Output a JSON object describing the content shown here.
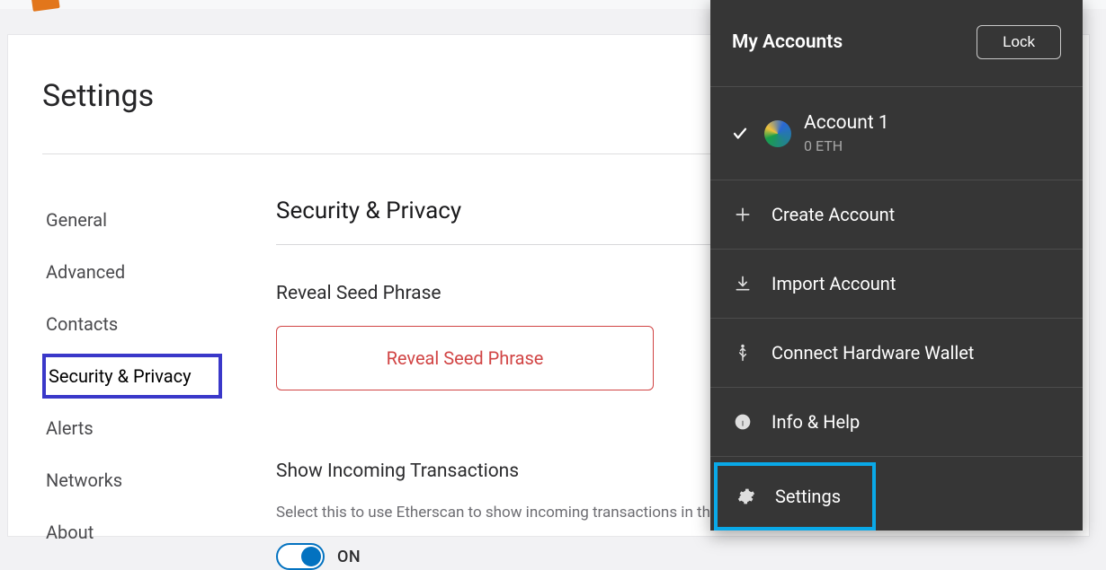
{
  "page": {
    "title": "Settings"
  },
  "sidebar": {
    "items": [
      {
        "label": "General"
      },
      {
        "label": "Advanced"
      },
      {
        "label": "Contacts"
      },
      {
        "label": "Security & Privacy"
      },
      {
        "label": "Alerts"
      },
      {
        "label": "Networks"
      },
      {
        "label": "About"
      }
    ]
  },
  "content": {
    "section_title": "Security & Privacy",
    "reveal_heading": "Reveal Seed Phrase",
    "reveal_button": "Reveal Seed Phrase",
    "incoming_heading": "Show Incoming Transactions",
    "incoming_desc": "Select this to use Etherscan to show incoming transactions in the transactions list",
    "toggle_label": "ON"
  },
  "dropdown": {
    "title": "My Accounts",
    "lock_label": "Lock",
    "account": {
      "name": "Account 1",
      "balance": "0 ETH"
    },
    "menu": {
      "create": "Create Account",
      "import": "Import Account",
      "hardware": "Connect Hardware Wallet",
      "info": "Info & Help",
      "settings": "Settings"
    }
  }
}
